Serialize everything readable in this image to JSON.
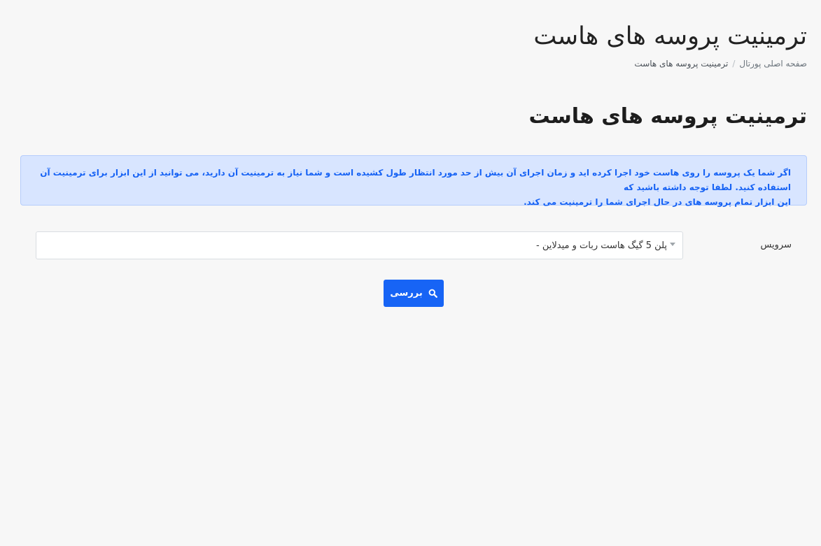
{
  "header": {
    "title": "ترمینیت پروسه های هاست",
    "breadcrumb": {
      "home": "صفحه اصلی پورتال",
      "separator": "/",
      "current": "ترمینیت پروسه های هاست"
    }
  },
  "main": {
    "heading": "ترمینیت پروسه های هاست",
    "alert": {
      "line1": "اگر شما یک پروسه را روی هاست خود اجرا کرده اید و زمان اجرای آن بیش از حد مورد انتظار طول کشیده است و شما نیاز به ترمینیت آن دارید، می توانید از این ابزار برای ترمینیت آن استفاده کنید. لطفا توجه داشته باشید که",
      "line2": "این ابزار تمام پروسه های در حال اجرای شما را ترمینیت می کند."
    },
    "form": {
      "service_label": "سرویس",
      "service_value": "پلن 5 گیگ هاست ربات و میدلاین -",
      "submit_label": "بررسی"
    }
  },
  "icons": {
    "submit_icon": "search-icon",
    "select_icon": "caret-down-icon"
  },
  "colors": {
    "primary": "#1764f5",
    "alert_bg": "#d8e5ff",
    "alert_text": "#1662f4",
    "page_bg": "#f7f7f7"
  }
}
